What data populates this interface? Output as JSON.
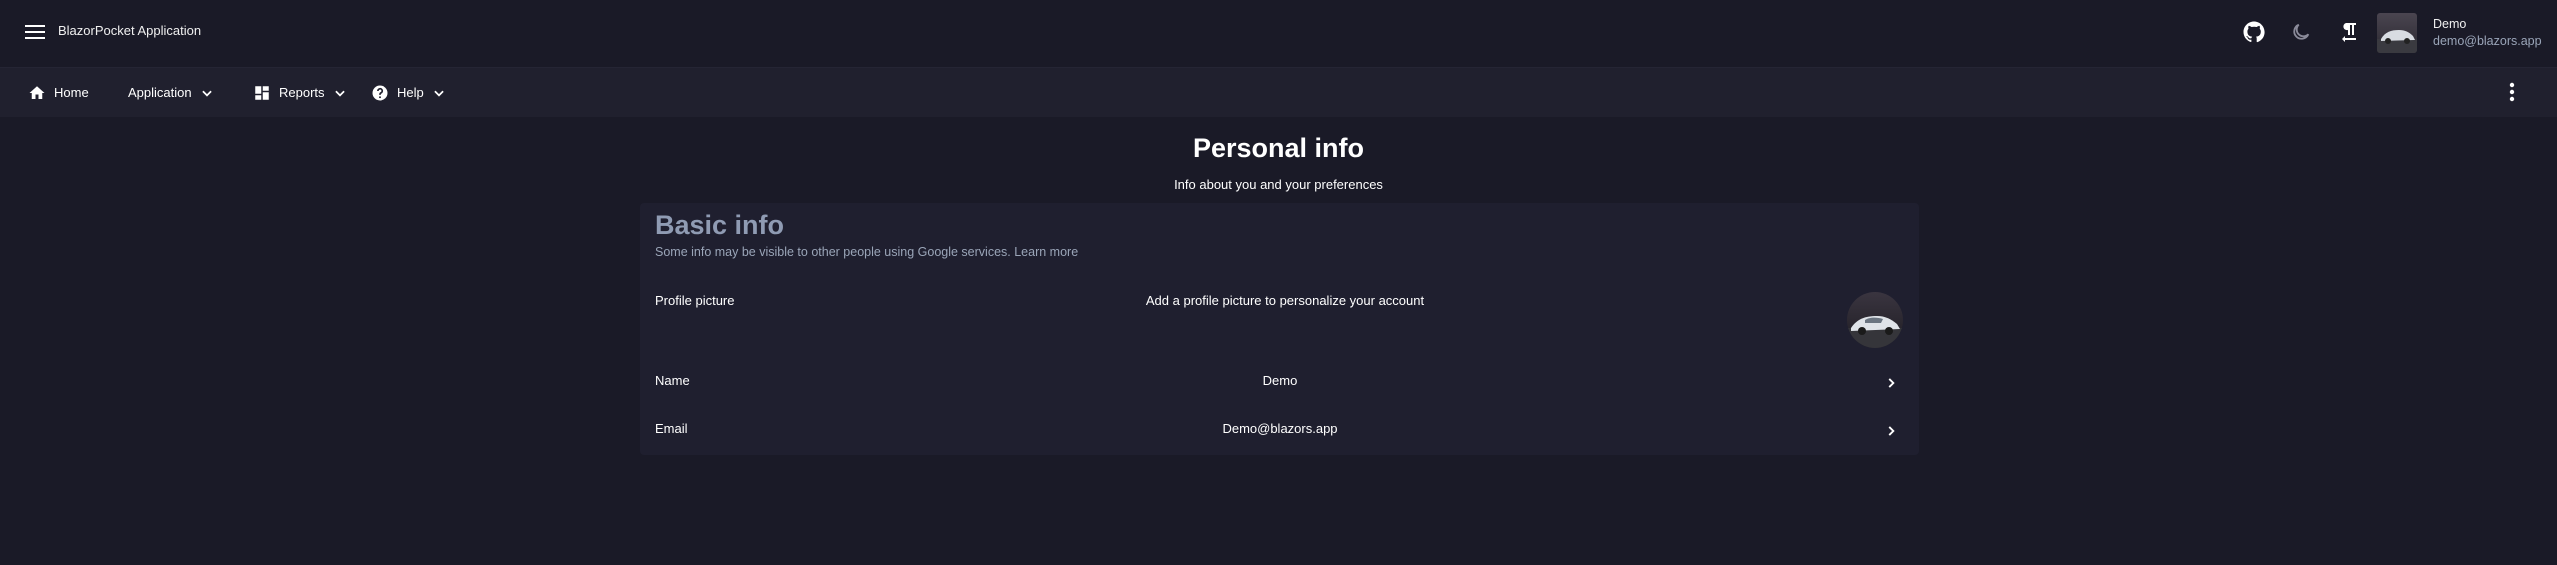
{
  "appbar": {
    "title": "BlazorPocket Application",
    "user": {
      "name": "Demo",
      "email": "demo@blazors.app"
    },
    "icons": [
      "menu-icon",
      "github-icon",
      "dark-mode-icon",
      "rtl-icon"
    ]
  },
  "nav": {
    "items": [
      {
        "label": "Home",
        "icon": "home-icon"
      },
      {
        "label": "Application"
      },
      {
        "label": "Reports",
        "icon": "dashboard-icon"
      },
      {
        "label": "Help",
        "icon": "help-icon"
      }
    ],
    "more_icon": "more-vert-icon"
  },
  "page": {
    "title": "Personal info",
    "subtitle": "Info about you and your preferences"
  },
  "basic_info": {
    "title": "Basic info",
    "subtitle": "Some info may be visible to other people using Google services.",
    "learn_more": "Learn more",
    "rows": [
      {
        "label": "Profile picture",
        "value": "Add a profile picture to personalize your account"
      },
      {
        "label": "Name",
        "value": "Demo"
      },
      {
        "label": "Email",
        "value": "Demo@blazors.app"
      }
    ]
  },
  "colors": {
    "background": "#1a1a27",
    "navbar": "#20202e",
    "card": "#1f1f2f",
    "muted_text": "#9aa5b8",
    "heading_muted": "#8f9bb3"
  }
}
